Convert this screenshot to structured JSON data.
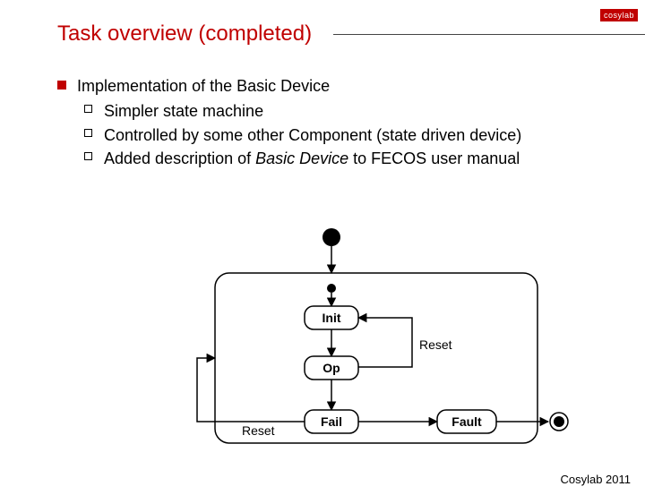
{
  "logo": "cosylab",
  "title": "Task overview (completed)",
  "bullets": {
    "main": "Implementation of the Basic Device",
    "sub": [
      "Simpler state machine",
      "Controlled by some other Component (state driven device)"
    ],
    "sub3_pre": "Added description of ",
    "sub3_em": "Basic Device",
    "sub3_post": " to FECOS user manual"
  },
  "diagram": {
    "states": {
      "init": "Init",
      "op": "Op",
      "fail": "Fail",
      "fault": "Fault"
    },
    "labels": {
      "reset_inner": "Reset",
      "reset_outer": "Reset"
    }
  },
  "footer": "Cosylab 2011"
}
